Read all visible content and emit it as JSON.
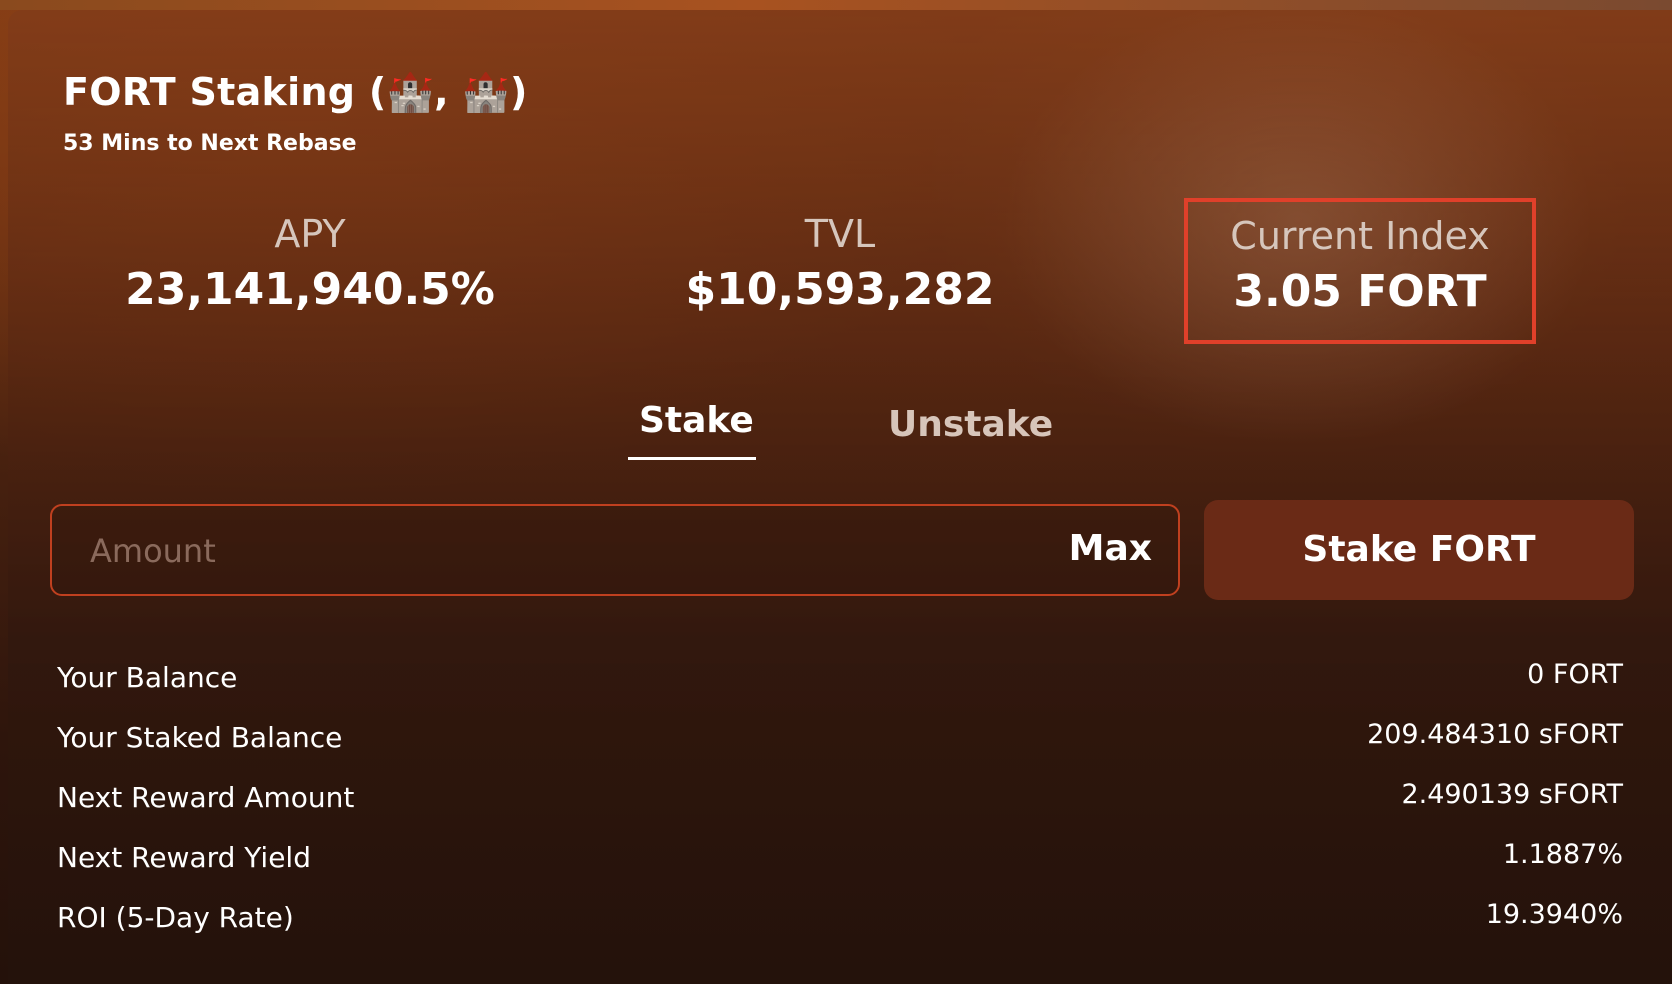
{
  "header": {
    "title": "FORT Staking (🏰, 🏰)",
    "subtitle": "53 Mins to Next Rebase"
  },
  "metrics": {
    "apy": {
      "label": "APY",
      "value": "23,141,940.5%"
    },
    "tvl": {
      "label": "TVL",
      "value": "$10,593,282"
    },
    "index": {
      "label": "Current Index",
      "value": "3.05 FORT"
    }
  },
  "tabs": {
    "stake": "Stake",
    "unstake": "Unstake",
    "active": "stake"
  },
  "form": {
    "amount_placeholder": "Amount",
    "amount_value": "",
    "max_label": "Max",
    "submit_label": "Stake FORT"
  },
  "stats": [
    {
      "label": "Your Balance",
      "value": "0 FORT"
    },
    {
      "label": "Your Staked Balance",
      "value": "209.484310 sFORT"
    },
    {
      "label": "Next Reward Amount",
      "value": "2.490139 sFORT"
    },
    {
      "label": "Next Reward Yield",
      "value": "1.1887%"
    },
    {
      "label": "ROI (5-Day Rate)",
      "value": "19.3940%"
    }
  ],
  "colors": {
    "highlight_border": "#e0402a",
    "input_border": "#c0401f",
    "button_bg": "#6a2a16"
  }
}
